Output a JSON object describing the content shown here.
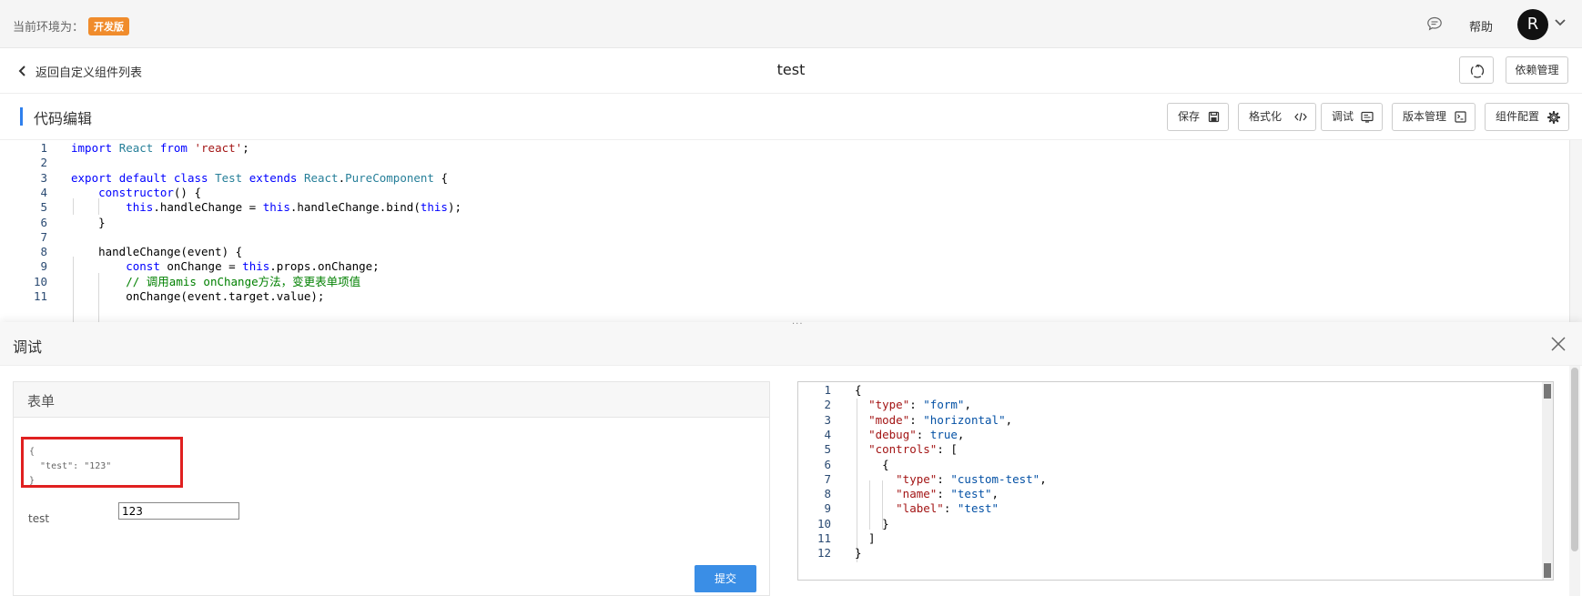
{
  "env": {
    "label": "当前环境为：",
    "badge": "开发版"
  },
  "topbar": {
    "help": "帮助",
    "avatar": "R"
  },
  "nav": {
    "back": "返回自定义组件列表",
    "title": "test",
    "dependency_button": "依赖管理"
  },
  "editor": {
    "title": "代码编辑",
    "toolbar": [
      {
        "label": "保存",
        "icon": "save-icon"
      },
      {
        "label": "格式化",
        "icon": "code-icon"
      },
      {
        "label": "调试",
        "icon": "terminal-icon"
      },
      {
        "label": "版本管理",
        "icon": "console-icon"
      },
      {
        "label": "组件配置",
        "icon": "gear-icon"
      }
    ],
    "lines": [
      {
        "n": "1",
        "tokens": [
          [
            "kw",
            "import"
          ],
          [
            "p",
            " "
          ],
          [
            "ty",
            "React"
          ],
          [
            "p",
            " "
          ],
          [
            "kw",
            "from"
          ],
          [
            "p",
            " "
          ],
          [
            "str",
            "'react'"
          ],
          [
            "p",
            ";"
          ]
        ]
      },
      {
        "n": "2",
        "tokens": []
      },
      {
        "n": "3",
        "tokens": [
          [
            "kw",
            "export"
          ],
          [
            "p",
            " "
          ],
          [
            "kw",
            "default"
          ],
          [
            "p",
            " "
          ],
          [
            "kw",
            "class"
          ],
          [
            "p",
            " "
          ],
          [
            "ty",
            "Test"
          ],
          [
            "p",
            " "
          ],
          [
            "kw",
            "extends"
          ],
          [
            "p",
            " "
          ],
          [
            "ty",
            "React"
          ],
          [
            "p",
            "."
          ],
          [
            "ty",
            "PureComponent"
          ],
          [
            "p",
            " {"
          ]
        ]
      },
      {
        "n": "4",
        "tokens": [
          [
            "p",
            "    "
          ],
          [
            "kw",
            "constructor"
          ],
          [
            "p",
            "() {"
          ]
        ]
      },
      {
        "n": "5",
        "tokens": [
          [
            "p",
            "        "
          ],
          [
            "kw",
            "this"
          ],
          [
            "p",
            ".handleChange = "
          ],
          [
            "kw",
            "this"
          ],
          [
            "p",
            ".handleChange.bind("
          ],
          [
            "kw",
            "this"
          ],
          [
            "p",
            ");"
          ]
        ]
      },
      {
        "n": "6",
        "tokens": [
          [
            "p",
            "    }"
          ]
        ]
      },
      {
        "n": "7",
        "tokens": []
      },
      {
        "n": "8",
        "tokens": [
          [
            "p",
            "    handleChange(event) {"
          ]
        ]
      },
      {
        "n": "9",
        "tokens": [
          [
            "p",
            "        "
          ],
          [
            "kw",
            "const"
          ],
          [
            "p",
            " onChange = "
          ],
          [
            "kw",
            "this"
          ],
          [
            "p",
            ".props.onChange;"
          ]
        ]
      },
      {
        "n": "10",
        "tokens": [
          [
            "p",
            "        "
          ],
          [
            "cm",
            "// 调用amis onChange方法，变更表单项值"
          ]
        ]
      },
      {
        "n": "11",
        "tokens": [
          [
            "p",
            "        onChange(event.target.value);"
          ]
        ]
      }
    ]
  },
  "debug": {
    "title": "调试",
    "form_title": "表单",
    "debug_lines": [
      "{",
      "  \"test\": \"123\"",
      "}"
    ],
    "field_label": "test",
    "field_value": "123",
    "submit": "提交",
    "json_lines": [
      {
        "n": "1",
        "tokens": [
          [
            "p",
            "{"
          ]
        ]
      },
      {
        "n": "2",
        "tokens": [
          [
            "p",
            "  "
          ],
          [
            "jk",
            "\"type\""
          ],
          [
            "p",
            ": "
          ],
          [
            "jv",
            "\"form\""
          ],
          [
            "p",
            ","
          ]
        ]
      },
      {
        "n": "3",
        "tokens": [
          [
            "p",
            "  "
          ],
          [
            "jk",
            "\"mode\""
          ],
          [
            "p",
            ": "
          ],
          [
            "jv",
            "\"horizontal\""
          ],
          [
            "p",
            ","
          ]
        ]
      },
      {
        "n": "4",
        "tokens": [
          [
            "p",
            "  "
          ],
          [
            "jk",
            "\"debug\""
          ],
          [
            "p",
            ": "
          ],
          [
            "jv",
            "true"
          ],
          [
            "p",
            ","
          ]
        ]
      },
      {
        "n": "5",
        "tokens": [
          [
            "p",
            "  "
          ],
          [
            "jk",
            "\"controls\""
          ],
          [
            "p",
            ": ["
          ]
        ]
      },
      {
        "n": "6",
        "tokens": [
          [
            "p",
            "    {"
          ]
        ]
      },
      {
        "n": "7",
        "tokens": [
          [
            "p",
            "      "
          ],
          [
            "jk",
            "\"type\""
          ],
          [
            "p",
            ": "
          ],
          [
            "jv",
            "\"custom-test\""
          ],
          [
            "p",
            ","
          ]
        ]
      },
      {
        "n": "8",
        "tokens": [
          [
            "p",
            "      "
          ],
          [
            "jk",
            "\"name\""
          ],
          [
            "p",
            ": "
          ],
          [
            "jv",
            "\"test\""
          ],
          [
            "p",
            ","
          ]
        ]
      },
      {
        "n": "9",
        "tokens": [
          [
            "p",
            "      "
          ],
          [
            "jk",
            "\"label\""
          ],
          [
            "p",
            ": "
          ],
          [
            "jv",
            "\"test\""
          ]
        ]
      },
      {
        "n": "10",
        "tokens": [
          [
            "p",
            "    }"
          ]
        ]
      },
      {
        "n": "11",
        "tokens": [
          [
            "p",
            "  ]"
          ]
        ]
      },
      {
        "n": "12",
        "tokens": [
          [
            "p",
            "}"
          ]
        ]
      }
    ]
  }
}
